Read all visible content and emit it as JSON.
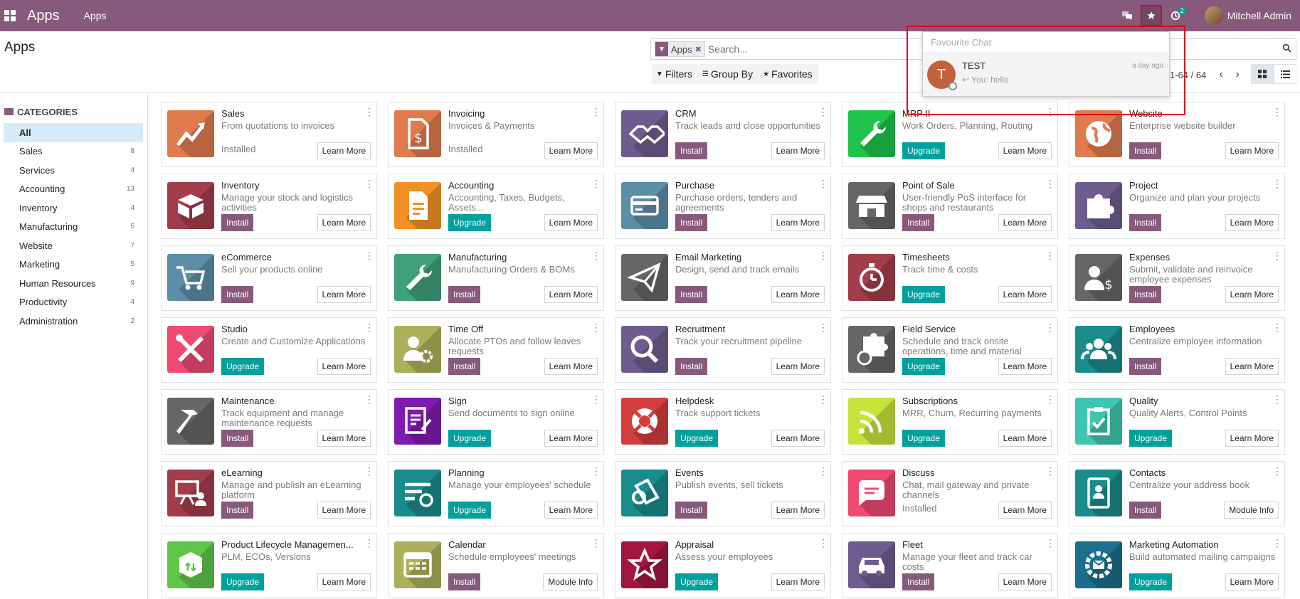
{
  "navbar": {
    "app_title": "Apps",
    "menu": "Apps",
    "activity_badge": "2",
    "user": "Mitchell Admin"
  },
  "control": {
    "breadcrumb": "Apps",
    "facet": "Apps",
    "search_placeholder": "Search...",
    "filters": "Filters",
    "group_by": "Group By",
    "favorites": "Favorites",
    "pager": "1-64 / 64"
  },
  "sidebar": {
    "title": "CATEGORIES",
    "items": [
      {
        "label": "All",
        "count": ""
      },
      {
        "label": "Sales",
        "count": "8"
      },
      {
        "label": "Services",
        "count": "4"
      },
      {
        "label": "Accounting",
        "count": "13"
      },
      {
        "label": "Inventory",
        "count": "4"
      },
      {
        "label": "Manufacturing",
        "count": "5"
      },
      {
        "label": "Website",
        "count": "7"
      },
      {
        "label": "Marketing",
        "count": "5"
      },
      {
        "label": "Human Resources",
        "count": "9"
      },
      {
        "label": "Productivity",
        "count": "4"
      },
      {
        "label": "Administration",
        "count": "2"
      }
    ]
  },
  "apps": [
    {
      "name": "Sales",
      "desc": "From quotations to invoices",
      "state": "installed",
      "status": "Installed",
      "more": "Learn More",
      "color": "#E07B4F",
      "icon": "chart-up-icon"
    },
    {
      "name": "Invoicing",
      "desc": "Invoices & Payments",
      "state": "installed",
      "status": "Installed",
      "more": "Learn More",
      "color": "#E07B4F",
      "icon": "invoice-dollar-icon"
    },
    {
      "name": "CRM",
      "desc": "Track leads and close opportunities",
      "state": "install",
      "status": "Install",
      "more": "Learn More",
      "color": "#6D5D8F",
      "icon": "handshake-icon"
    },
    {
      "name": "MRP II",
      "desc": "Work Orders, Planning, Routing",
      "state": "upgrade",
      "status": "Upgrade",
      "more": "Learn More",
      "color": "#1EC44B",
      "icon": "wrench-icon"
    },
    {
      "name": "Website",
      "desc": "Enterprise website builder",
      "state": "install",
      "status": "Install",
      "more": "Learn More",
      "color": "#E07B4F",
      "icon": "globe-icon"
    },
    {
      "name": "Inventory",
      "desc": "Manage your stock and logistics activities",
      "state": "install",
      "status": "Install",
      "more": "Learn More",
      "color": "#A33D4B",
      "icon": "box-icon"
    },
    {
      "name": "Accounting",
      "desc": "Accounting, Taxes, Budgets, Assets...",
      "state": "upgrade",
      "status": "Upgrade",
      "more": "Learn More",
      "color": "#F39224",
      "icon": "document-icon"
    },
    {
      "name": "Purchase",
      "desc": "Purchase orders, tenders and agreements",
      "state": "install",
      "status": "Install",
      "more": "Learn More",
      "color": "#5D8EA8",
      "icon": "credit-card-icon"
    },
    {
      "name": "Point of Sale",
      "desc": "User-friendly PoS interface for shops and restaurants",
      "state": "install",
      "status": "Install",
      "more": "Learn More",
      "color": "#666666",
      "icon": "shop-icon"
    },
    {
      "name": "Project",
      "desc": "Organize and plan your projects",
      "state": "install",
      "status": "Install",
      "more": "Learn More",
      "color": "#6D5D8F",
      "icon": "puzzle-icon"
    },
    {
      "name": "eCommerce",
      "desc": "Sell your products online",
      "state": "install",
      "status": "Install",
      "more": "Learn More",
      "color": "#5D8EA8",
      "icon": "cart-icon"
    },
    {
      "name": "Manufacturing",
      "desc": "Manufacturing Orders & BOMs",
      "state": "install",
      "status": "Install",
      "more": "Learn More",
      "color": "#3FA07A",
      "icon": "wrench-icon"
    },
    {
      "name": "Email Marketing",
      "desc": "Design, send and track emails",
      "state": "install",
      "status": "Install",
      "more": "Learn More",
      "color": "#666666",
      "icon": "paper-plane-icon"
    },
    {
      "name": "Timesheets",
      "desc": "Track time & costs",
      "state": "upgrade",
      "status": "Upgrade",
      "more": "Learn More",
      "color": "#A33D4B",
      "icon": "stopwatch-icon"
    },
    {
      "name": "Expenses",
      "desc": "Submit, validate and reinvoice employee expenses",
      "state": "install",
      "status": "Install",
      "more": "Learn More",
      "color": "#666666",
      "icon": "user-dollar-icon"
    },
    {
      "name": "Studio",
      "desc": "Create and Customize Applications",
      "state": "upgrade",
      "status": "Upgrade",
      "more": "Learn More",
      "color": "#EF4A72",
      "icon": "tools-icon"
    },
    {
      "name": "Time Off",
      "desc": "Allocate PTOs and follow leaves requests",
      "state": "install",
      "status": "Install",
      "more": "Learn More",
      "color": "#AAB15A",
      "icon": "user-gear-icon"
    },
    {
      "name": "Recruitment",
      "desc": "Track your recruitment pipeline",
      "state": "install",
      "status": "Install",
      "more": "Learn More",
      "color": "#6D5D8F",
      "icon": "magnifier-icon"
    },
    {
      "name": "Field Service",
      "desc": "Schedule and track onsite operations, time and material",
      "state": "upgrade",
      "status": "Upgrade",
      "more": "Learn More",
      "color": "#666666",
      "icon": "puzzle-clock-icon"
    },
    {
      "name": "Employees",
      "desc": "Centralize employee information",
      "state": "install",
      "status": "Install",
      "more": "Learn More",
      "color": "#1B8C8C",
      "icon": "users-icon"
    },
    {
      "name": "Maintenance",
      "desc": "Track equipment and manage maintenance requests",
      "state": "install",
      "status": "Install",
      "more": "Learn More",
      "color": "#666666",
      "icon": "hammer-icon"
    },
    {
      "name": "Sign",
      "desc": "Send documents to sign online",
      "state": "upgrade",
      "status": "Upgrade",
      "more": "Learn More",
      "color": "#7F1BAF",
      "icon": "sign-document-icon"
    },
    {
      "name": "Helpdesk",
      "desc": "Track support tickets",
      "state": "upgrade",
      "status": "Upgrade",
      "more": "Learn More",
      "color": "#D23E3E",
      "icon": "lifebuoy-icon"
    },
    {
      "name": "Subscriptions",
      "desc": "MRR, Churn, Recurring payments",
      "state": "upgrade",
      "status": "Upgrade",
      "more": "Learn More",
      "color": "#C6E33B",
      "icon": "rss-icon"
    },
    {
      "name": "Quality",
      "desc": "Quality Alerts, Control Points",
      "state": "upgrade",
      "status": "Upgrade",
      "more": "Learn More",
      "color": "#40C6B0",
      "icon": "clipboard-check-icon"
    },
    {
      "name": "eLearning",
      "desc": "Manage and publish an eLearning platform",
      "state": "install",
      "status": "Install",
      "more": "Learn More",
      "color": "#A33D4B",
      "icon": "presentation-icon"
    },
    {
      "name": "Planning",
      "desc": "Manage your employees' schedule",
      "state": "upgrade",
      "status": "Upgrade",
      "more": "Learn More",
      "color": "#1B8C8C",
      "icon": "planning-icon"
    },
    {
      "name": "Events",
      "desc": "Publish events, sell tickets",
      "state": "install",
      "status": "Install",
      "more": "Learn More",
      "color": "#1B8C8C",
      "icon": "ticket-icon"
    },
    {
      "name": "Discuss",
      "desc": "Chat, mail gateway and private channels",
      "state": "installed",
      "status": "Installed",
      "more": "Learn More",
      "color": "#EF4A72",
      "icon": "chat-bubble-icon"
    },
    {
      "name": "Contacts",
      "desc": "Centralize your address book",
      "state": "install",
      "status": "Install",
      "more": "Module Info",
      "color": "#1B8C8C",
      "icon": "address-book-icon"
    },
    {
      "name": "Product Lifecycle Managemen...",
      "desc": "PLM, ECOs, Versions",
      "state": "upgrade",
      "status": "Upgrade",
      "more": "Learn More",
      "color": "#5FC64A",
      "icon": "box-arrows-icon"
    },
    {
      "name": "Calendar",
      "desc": "Schedule employees' meetings",
      "state": "install",
      "status": "Install",
      "more": "Module Info",
      "color": "#AAB15A",
      "icon": "calendar-icon"
    },
    {
      "name": "Appraisal",
      "desc": "Assess your employees",
      "state": "upgrade",
      "status": "Upgrade",
      "more": "Learn More",
      "color": "#A3173F",
      "icon": "star-icon"
    },
    {
      "name": "Fleet",
      "desc": "Manage your fleet and track car costs",
      "state": "install",
      "status": "Install",
      "more": "Learn More",
      "color": "#6D5D8F",
      "icon": "car-icon"
    },
    {
      "name": "Marketing Automation",
      "desc": "Build automated mailing campaigns",
      "state": "upgrade",
      "status": "Upgrade",
      "more": "Learn More",
      "color": "#1B6E8C",
      "icon": "gear-mail-icon"
    }
  ],
  "popover": {
    "search_placeholder": "Favourite Chat",
    "avatar_letter": "T",
    "name": "TEST",
    "time": "a day ago",
    "message": "You: hello"
  }
}
